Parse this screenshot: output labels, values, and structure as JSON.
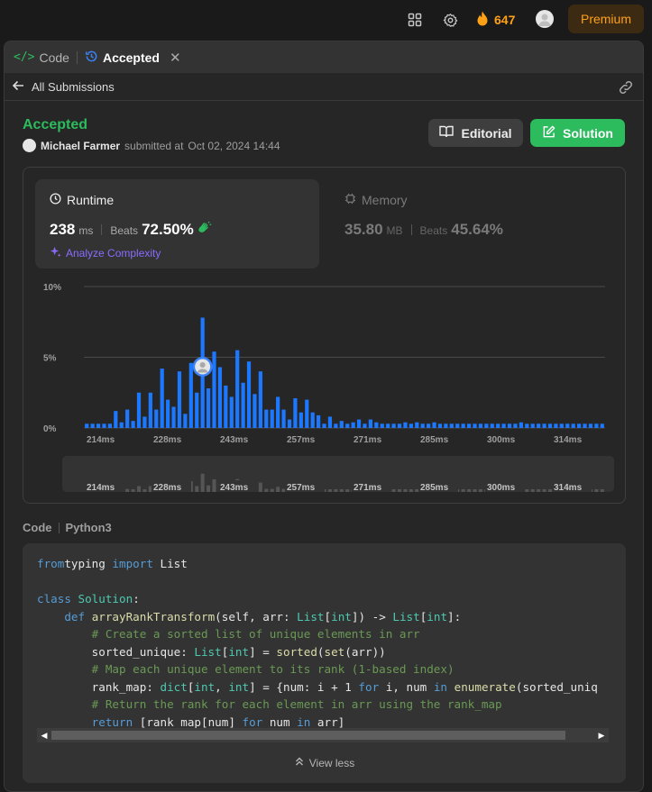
{
  "topbar": {
    "streak_count": "647",
    "premium_label": "Premium"
  },
  "tabs": {
    "code_label": "Code",
    "accepted_label": "Accepted"
  },
  "subbar": {
    "back_label": "All Submissions"
  },
  "submission": {
    "status": "Accepted",
    "user": "Michael Farmer",
    "submitted_prefix": "submitted at",
    "submitted_date": "Oct 02, 2024 14:44",
    "editorial_label": "Editorial",
    "solution_label": "Solution"
  },
  "runtime": {
    "label": "Runtime",
    "value": "238",
    "unit": "ms",
    "beats_label": "Beats",
    "beats_value": "72.50%",
    "analyze_label": "Analyze Complexity"
  },
  "memory": {
    "label": "Memory",
    "value": "35.80",
    "unit": "MB",
    "beats_label": "Beats",
    "beats_value": "45.64%"
  },
  "chart_data": {
    "type": "bar",
    "ylabel": "",
    "xlabel": "",
    "y_ticks": [
      "10%",
      "5%",
      "0%"
    ],
    "ylim": [
      0,
      10
    ],
    "x_tick_labels": [
      "214ms",
      "228ms",
      "243ms",
      "257ms",
      "271ms",
      "285ms",
      "300ms",
      "314ms"
    ],
    "values": [
      0.3,
      0.3,
      0.3,
      0.3,
      0.3,
      1.2,
      0.4,
      1.3,
      0.5,
      2.5,
      0.8,
      2.5,
      1.3,
      4.2,
      2.0,
      1.5,
      4.0,
      1.0,
      4.6,
      2.5,
      7.8,
      2.8,
      5.4,
      4.3,
      3.0,
      2.2,
      5.5,
      3.2,
      4.7,
      2.4,
      4.0,
      1.3,
      1.3,
      2.2,
      1.3,
      0.6,
      2.1,
      1.1,
      2.0,
      1.1,
      0.9,
      0.3,
      0.8,
      0.3,
      0.5,
      0.3,
      0.4,
      0.6,
      0.3,
      0.6,
      0.4,
      0.3,
      0.3,
      0.3,
      0.3,
      0.4,
      0.3,
      0.4,
      0.3,
      0.3,
      0.4,
      0.3,
      0.3,
      0.3,
      0.3,
      0.3,
      0.3,
      0.3,
      0.3,
      0.3,
      0.3,
      0.3,
      0.3,
      0.3,
      0.3,
      0.4,
      0.3,
      0.3,
      0.3,
      0.3,
      0.3,
      0.3,
      0.3,
      0.3,
      0.3,
      0.3,
      0.3,
      0.3,
      0.3,
      0.3
    ],
    "marker_index": 20,
    "colors": {
      "bar": "#1c78ff",
      "grid": "#4a4a4a",
      "tick": "#9e9e9e"
    }
  },
  "code_section": {
    "label": "Code",
    "language": "Python3",
    "view_less_label": "View less"
  },
  "code_lines": [
    [
      [
        "kw",
        "from"
      ],
      [
        "",
        "typing "
      ],
      [
        "kw",
        "import"
      ],
      [
        "",
        " List"
      ]
    ],
    [],
    [
      [
        "kw",
        "class"
      ],
      [
        "",
        " "
      ],
      [
        "cls",
        "Solution"
      ],
      [
        "",
        ":"
      ]
    ],
    [
      [
        "",
        "    "
      ],
      [
        "kw",
        "def"
      ],
      [
        "",
        " "
      ],
      [
        "fn",
        "arrayRankTransform"
      ],
      [
        "",
        "(self, arr: "
      ],
      [
        "ty",
        "List"
      ],
      [
        "",
        "["
      ],
      [
        "ty",
        "int"
      ],
      [
        "",
        "]) -> "
      ],
      [
        "ty",
        "List"
      ],
      [
        "",
        "["
      ],
      [
        "ty",
        "int"
      ],
      [
        "",
        "]:"
      ]
    ],
    [
      [
        "",
        "        "
      ],
      [
        "cm",
        "# Create a sorted list of unique elements in arr"
      ]
    ],
    [
      [
        "",
        "        sorted_unique: "
      ],
      [
        "ty",
        "List"
      ],
      [
        "",
        "["
      ],
      [
        "ty",
        "int"
      ],
      [
        "",
        "] = "
      ],
      [
        "bi",
        "sorted"
      ],
      [
        "",
        "("
      ],
      [
        "bi",
        "set"
      ],
      [
        "",
        "(arr))"
      ]
    ],
    [
      [
        "",
        "        "
      ],
      [
        "cm",
        "# Map each unique element to its rank (1-based index)"
      ]
    ],
    [
      [
        "",
        "        rank_map: "
      ],
      [
        "ty",
        "dict"
      ],
      [
        "",
        "["
      ],
      [
        "ty",
        "int"
      ],
      [
        "",
        ", "
      ],
      [
        "ty",
        "int"
      ],
      [
        "",
        "] = {num: i + 1 "
      ],
      [
        "kw",
        "for"
      ],
      [
        "",
        " i, num "
      ],
      [
        "kw",
        "in"
      ],
      [
        "",
        " "
      ],
      [
        "bi",
        "enumerate"
      ],
      [
        "",
        "(sorted_uniq"
      ]
    ],
    [
      [
        "",
        "        "
      ],
      [
        "cm",
        "# Return the rank for each element in arr using the rank_map"
      ]
    ],
    [
      [
        "",
        "        "
      ],
      [
        "kw",
        "return"
      ],
      [
        "",
        " [rank_map[num] "
      ],
      [
        "kw",
        "for"
      ],
      [
        "",
        " num "
      ],
      [
        "kw",
        "in"
      ],
      [
        "",
        " arr]"
      ]
    ]
  ]
}
